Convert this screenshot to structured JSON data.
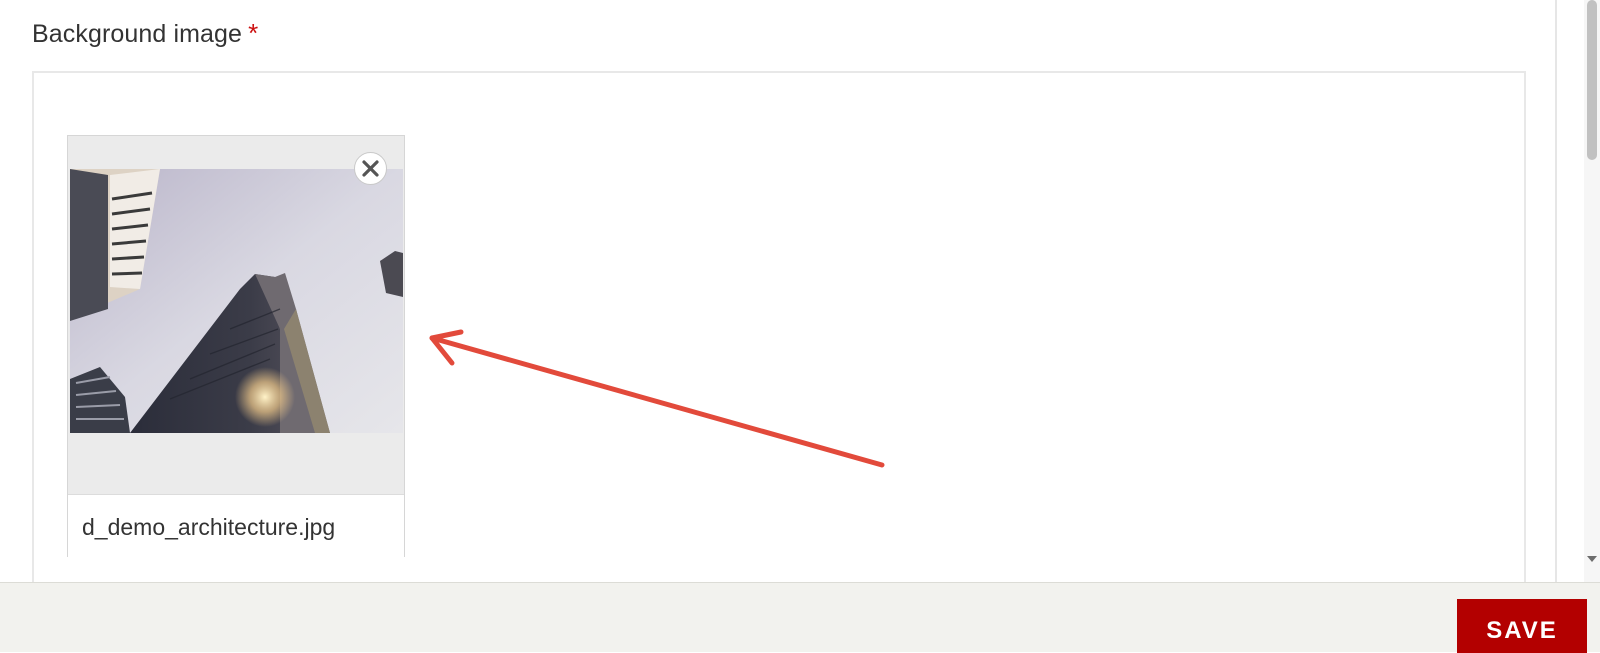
{
  "field": {
    "label": "Background image",
    "required_mark": "*"
  },
  "upload": {
    "file_name": "d_demo_architecture.jpg",
    "thumbnail_subject": "skyscraper-photo",
    "remove_icon": "close-icon"
  },
  "footer": {
    "save_label": "SAVE"
  },
  "colors": {
    "accent": "#b30000",
    "required": "#cc1010",
    "annotation_arrow": "#e24a3b"
  }
}
